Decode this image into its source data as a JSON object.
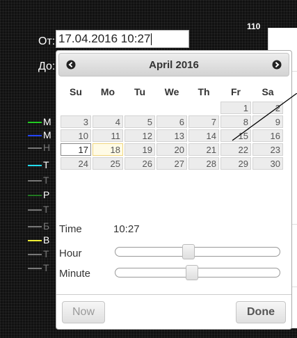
{
  "form": {
    "from_label": "От:",
    "from_value": "17.04.2016 10:27",
    "to_label": "До:",
    "badge": "110"
  },
  "legend": [
    {
      "text": "М",
      "color": "#22cc22"
    },
    {
      "text": "М",
      "color": "#2244ff"
    },
    {
      "text": "Н",
      "color": "#777777"
    },
    {
      "text": "Т",
      "color": "#22ddee"
    },
    {
      "text": "Т",
      "color": "#777777"
    },
    {
      "text": "Р",
      "color": "#227722"
    },
    {
      "text": "Т",
      "color": "#777777"
    },
    {
      "text": "Б",
      "color": "#777777"
    },
    {
      "text": "В",
      "color": "#eeee33"
    },
    {
      "text": "Т",
      "color": "#777777"
    },
    {
      "text": "Т",
      "color": "#777777"
    }
  ],
  "datepicker": {
    "title": "April 2016",
    "prev_icon": "circle-left-arrow-icon",
    "next_icon": "circle-right-arrow-icon",
    "weekdays": [
      "Su",
      "Mo",
      "Tu",
      "We",
      "Th",
      "Fr",
      "Sa"
    ],
    "weeks": [
      [
        "",
        "",
        "",
        "",
        "",
        "1",
        "2"
      ],
      [
        "3",
        "4",
        "5",
        "6",
        "7",
        "8",
        "9"
      ],
      [
        "10",
        "11",
        "12",
        "13",
        "14",
        "15",
        "16"
      ],
      [
        "17",
        "18",
        "19",
        "20",
        "21",
        "22",
        "23"
      ],
      [
        "24",
        "25",
        "26",
        "27",
        "28",
        "29",
        "30"
      ]
    ],
    "selected_day": "17",
    "today_day": "18",
    "time_label": "Time",
    "time_value": "10:27",
    "hour_label": "Hour",
    "hour_fraction": 0.435,
    "minute_label": "Minute",
    "minute_fraction": 0.458,
    "now_label": "Now",
    "done_label": "Done"
  }
}
